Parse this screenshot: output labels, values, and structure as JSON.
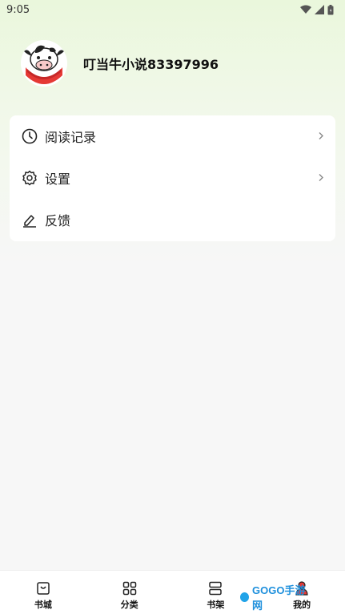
{
  "status_bar": {
    "time": "9:05"
  },
  "profile": {
    "username": "叮当牛小说83397996"
  },
  "menu": [
    {
      "label": "阅读记录",
      "icon": "clock-icon",
      "has_arrow": true
    },
    {
      "label": "设置",
      "icon": "gear-icon",
      "has_arrow": true
    },
    {
      "label": "反馈",
      "icon": "edit-icon",
      "has_arrow": false
    }
  ],
  "bottom_nav": [
    {
      "label": "书城",
      "icon": "bag-icon"
    },
    {
      "label": "分类",
      "icon": "grid-icon"
    },
    {
      "label": "书架",
      "icon": "books-icon"
    },
    {
      "label": "我的",
      "icon": "person-icon",
      "active": true
    }
  ],
  "watermark": {
    "text": "GOGO手游网"
  },
  "colors": {
    "accent_red": "#e53935",
    "background": "#f7f7f7",
    "gradient_top": "#eaf7dc"
  }
}
